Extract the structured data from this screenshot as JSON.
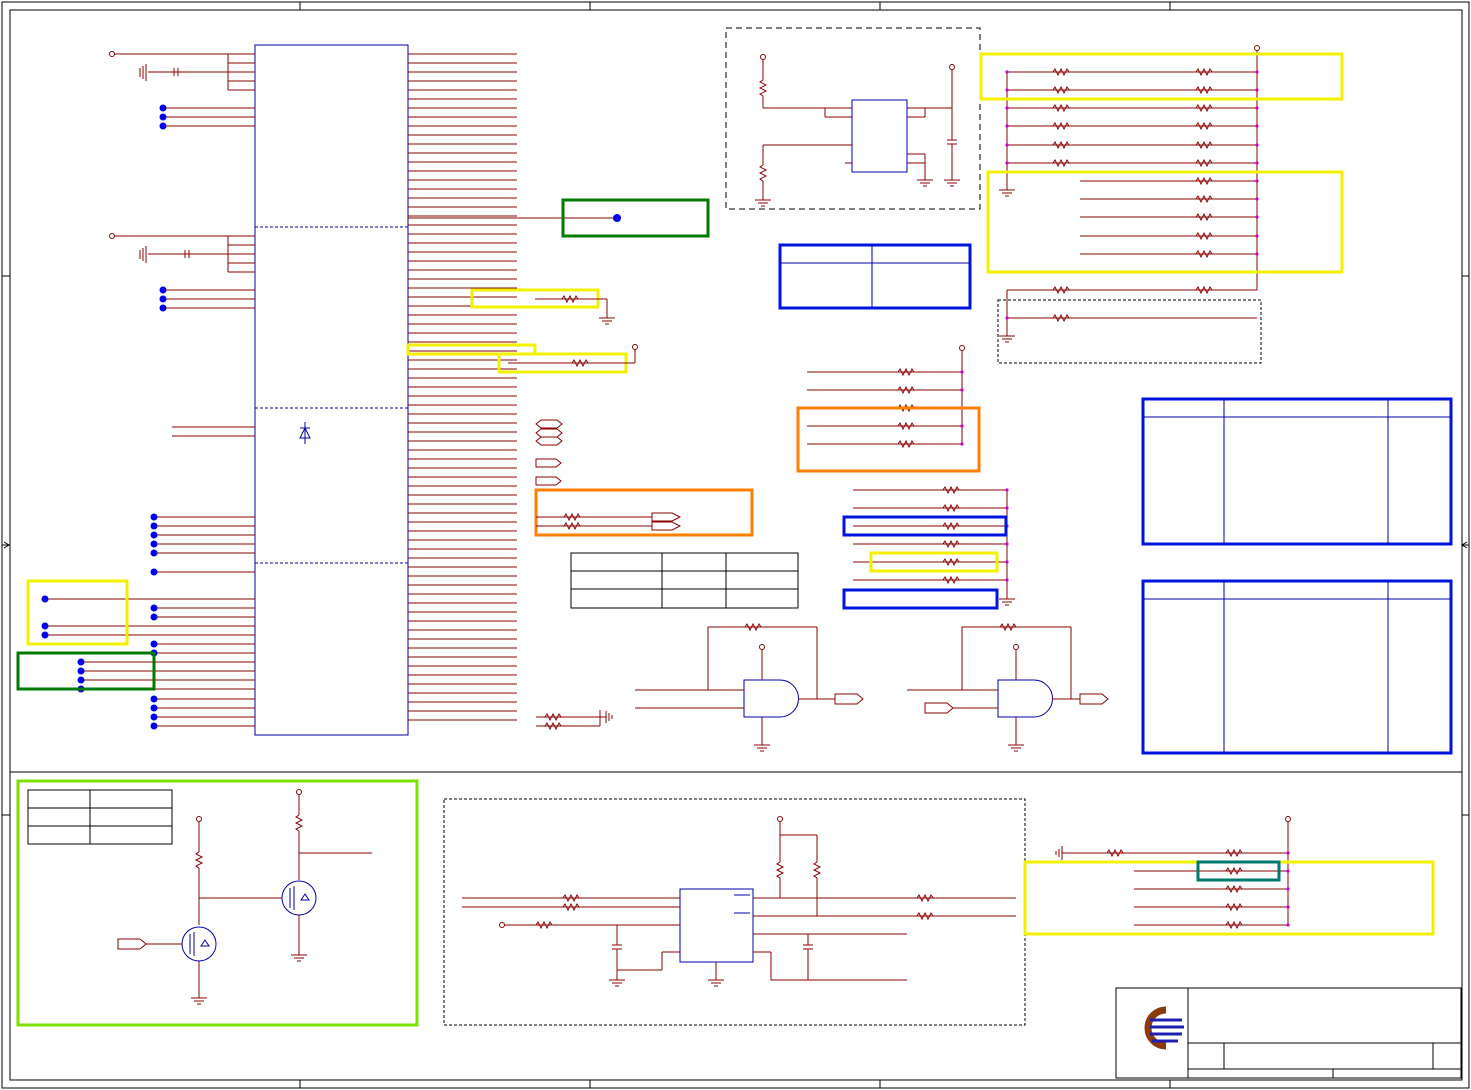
{
  "sheet": {
    "title": "",
    "colors": {
      "wire": "#8b0000",
      "connector_dot": "#0000ee",
      "junction": "#cc00cc",
      "highlight_yellow": "#f2f200",
      "highlight_green": "#007a00",
      "highlight_blue": "#0014dc",
      "highlight_orange": "#ff7f00",
      "highlight_light_green": "#7ce000",
      "highlight_teal": "#007a6e",
      "logo": "#8b3a0a"
    },
    "icons": [
      "company-logo-icon",
      "ground-icon",
      "resistor-icon",
      "capacitor-icon",
      "and-gate-icon",
      "mosfet-icon",
      "diode-icon",
      "off-page-connector-icon"
    ]
  }
}
